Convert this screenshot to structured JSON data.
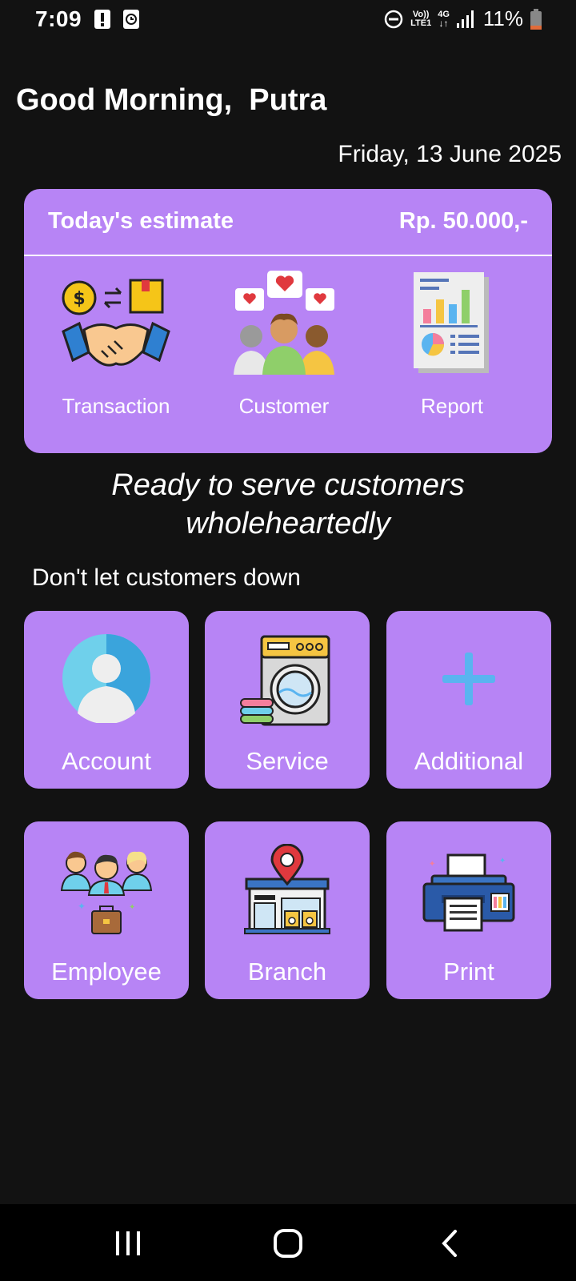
{
  "status_bar": {
    "time": "7:09",
    "network_top": "Vo))",
    "network_bottom": "LTE1",
    "network_type": "4G",
    "battery": "11%"
  },
  "header": {
    "greeting": "Good Morning,  Putra",
    "date": "Friday, 13 June 2025"
  },
  "estimate": {
    "label": "Today's estimate",
    "value": "Rp. 50.000,-",
    "menu": [
      {
        "label": "Transaction",
        "icon": "handshake-exchange-icon"
      },
      {
        "label": "Customer",
        "icon": "customers-hearts-icon"
      },
      {
        "label": "Report",
        "icon": "report-chart-icon"
      }
    ]
  },
  "tagline": {
    "line1": "Ready to serve customers",
    "line2": "wholeheartedly"
  },
  "subtitle": "Don't let customers down",
  "tiles": [
    {
      "label": "Account",
      "icon": "account-avatar-icon"
    },
    {
      "label": "Service",
      "icon": "washing-machine-icon"
    },
    {
      "label": "Additional",
      "icon": "plus-icon"
    },
    {
      "label": "Employee",
      "icon": "employees-group-icon"
    },
    {
      "label": "Branch",
      "icon": "branch-store-icon"
    },
    {
      "label": "Print",
      "icon": "printer-icon"
    }
  ],
  "colors": {
    "background": "#121212",
    "card": "#b784f5",
    "accent_blue": "#5ab4f0"
  }
}
